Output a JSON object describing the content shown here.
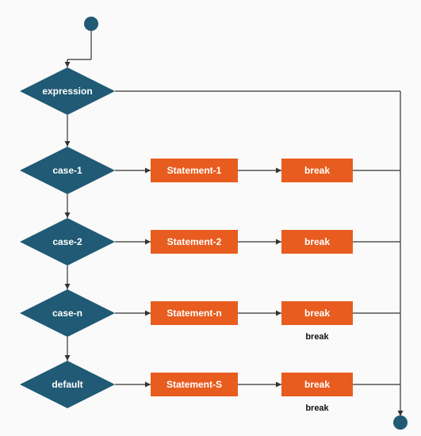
{
  "chart_data": {
    "type": "flowchart",
    "title": "",
    "nodes": [
      {
        "id": "start",
        "shape": "circle",
        "label": ""
      },
      {
        "id": "expr",
        "shape": "diamond",
        "label": "expression"
      },
      {
        "id": "case1",
        "shape": "diamond",
        "label": "case-1"
      },
      {
        "id": "case2",
        "shape": "diamond",
        "label": "case-2"
      },
      {
        "id": "casen",
        "shape": "diamond",
        "label": "case-n"
      },
      {
        "id": "default",
        "shape": "diamond",
        "label": "default"
      },
      {
        "id": "stmt1",
        "shape": "rect",
        "label": "Statement-1"
      },
      {
        "id": "stmt2",
        "shape": "rect",
        "label": "Statement-2"
      },
      {
        "id": "stmtn",
        "shape": "rect",
        "label": "Statement-n"
      },
      {
        "id": "stmts",
        "shape": "rect",
        "label": "Statement-S"
      },
      {
        "id": "break1",
        "shape": "rect",
        "label": "break"
      },
      {
        "id": "break2",
        "shape": "rect",
        "label": "break"
      },
      {
        "id": "breakn",
        "shape": "rect",
        "label": "break"
      },
      {
        "id": "breaks",
        "shape": "rect",
        "label": "break"
      },
      {
        "id": "end",
        "shape": "circle",
        "label": ""
      }
    ],
    "edges": [
      {
        "from": "start",
        "to": "expr"
      },
      {
        "from": "expr",
        "to": "case1"
      },
      {
        "from": "case1",
        "to": "stmt1"
      },
      {
        "from": "case1",
        "to": "case2"
      },
      {
        "from": "case2",
        "to": "stmt2"
      },
      {
        "from": "case2",
        "to": "casen"
      },
      {
        "from": "casen",
        "to": "stmtn"
      },
      {
        "from": "casen",
        "to": "default"
      },
      {
        "from": "default",
        "to": "stmts"
      },
      {
        "from": "stmt1",
        "to": "break1"
      },
      {
        "from": "stmt2",
        "to": "break2"
      },
      {
        "from": "stmtn",
        "to": "breakn"
      },
      {
        "from": "stmts",
        "to": "breaks"
      },
      {
        "from": "break1",
        "to": "end"
      },
      {
        "from": "break2",
        "to": "end"
      },
      {
        "from": "breakn",
        "to": "end",
        "label": "break"
      },
      {
        "from": "breaks",
        "to": "end",
        "label": "break"
      }
    ]
  },
  "labels": {
    "expression": "expression",
    "case1": "case-1",
    "case2": "case-2",
    "casen": "case-n",
    "default": "default",
    "stmt1": "Statement-1",
    "stmt2": "Statement-2",
    "stmtn": "Statement-n",
    "stmts": "Statement-S",
    "break": "break",
    "breakEdge1": "break",
    "breakEdge2": "break"
  },
  "colors": {
    "diamond": "#205a74",
    "rect": "#e85c1f",
    "line": "#333333"
  }
}
